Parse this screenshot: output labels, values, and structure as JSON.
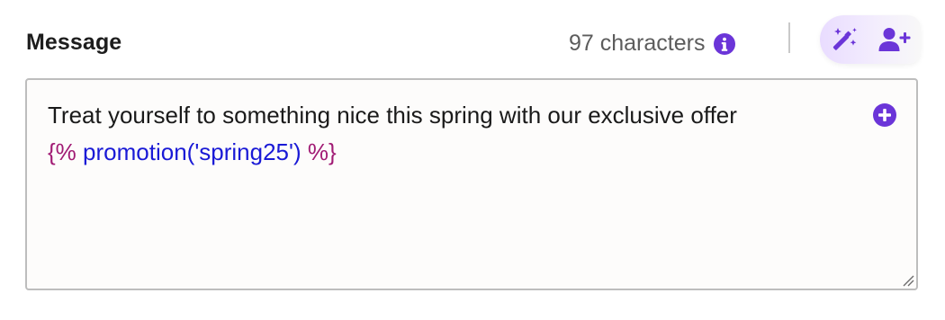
{
  "field": {
    "label": "Message",
    "character_count": "97 characters"
  },
  "editor": {
    "text": "Treat yourself to something nice this spring with our exclusive offer",
    "template_open": "{%",
    "template_expr": "promotion('spring25')",
    "template_close": "%}"
  },
  "icons": {
    "info": "info-circle-icon",
    "magic": "magic-wand-icon",
    "personalize": "add-person-icon",
    "insert": "plus-circle-icon",
    "resize": "resize-handle-icon"
  },
  "colors": {
    "accent": "#6b35d8",
    "template_delimiter": "#a11b74",
    "template_expression": "#1a1ad6"
  }
}
